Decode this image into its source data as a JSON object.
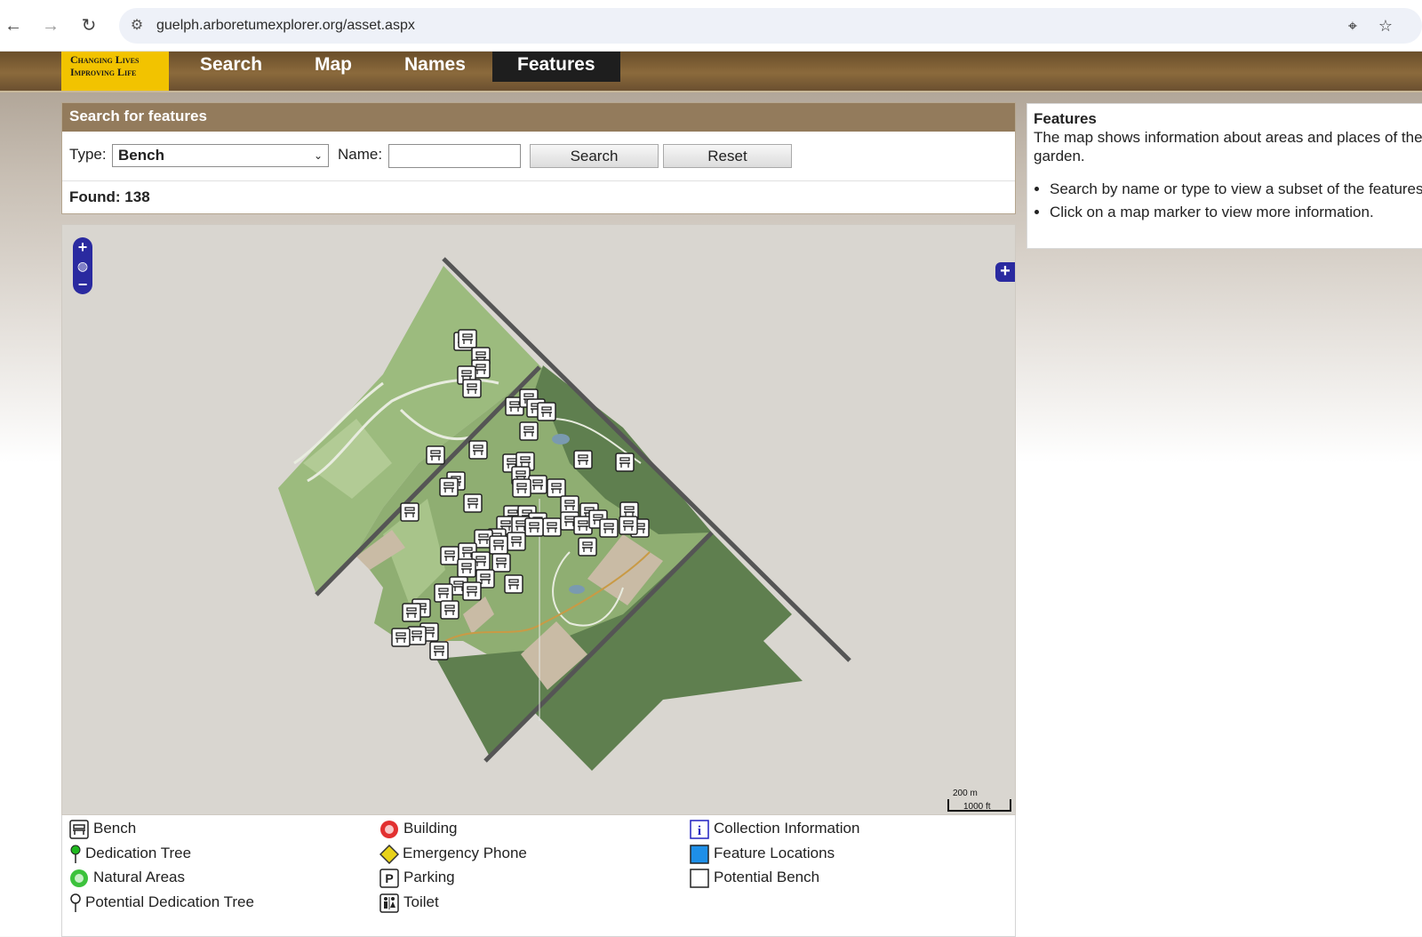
{
  "browser": {
    "url": "guelph.arboretumexplorer.org/asset.aspx",
    "back_icon": "back-arrow-icon",
    "forward_icon": "forward-arrow-icon",
    "reload_icon": "reload-icon"
  },
  "header": {
    "logo_line1": "Changing Lives",
    "logo_line2": "Improving Life",
    "nav": [
      "Search",
      "Map",
      "Names",
      "Features"
    ],
    "active": "Features"
  },
  "search": {
    "title": "Search for features",
    "type_label": "Type:",
    "type_value": "Bench",
    "name_label": "Name:",
    "name_value": "",
    "search_button": "Search",
    "reset_button": "Reset",
    "found_text": "Found: 138"
  },
  "info": {
    "title": "Features",
    "text": "The map shows information about areas and places of the garden.",
    "bullets": [
      "Search by name or type to view a subset of the features.",
      "Click on a map marker to view more information."
    ]
  },
  "map": {
    "scale_metric": "200 m",
    "scale_imperial": "1000 ft",
    "colors": {
      "light_green": "#9cbb7e",
      "dark_green": "#5f7f4f",
      "road": "#555555",
      "building": "#c9bba5",
      "background": "#d9d6d0"
    }
  },
  "legend": [
    {
      "label": "Bench",
      "icon": "bench-icon"
    },
    {
      "label": "Dedication Tree",
      "icon": "green-pin-icon"
    },
    {
      "label": "Natural Areas",
      "icon": "green-circle-icon"
    },
    {
      "label": "Potential Dedication Tree",
      "icon": "white-pin-icon"
    },
    {
      "label": "Building",
      "icon": "red-circle-icon"
    },
    {
      "label": "Emergency Phone",
      "icon": "yellow-diamond-icon"
    },
    {
      "label": "Parking",
      "icon": "parking-icon"
    },
    {
      "label": "Toilet",
      "icon": "toilet-icon"
    },
    {
      "label": "Collection Information",
      "icon": "info-icon"
    },
    {
      "label": "Feature Locations",
      "icon": "blue-square-icon"
    },
    {
      "label": "Potential Bench",
      "icon": "white-square-icon"
    }
  ]
}
